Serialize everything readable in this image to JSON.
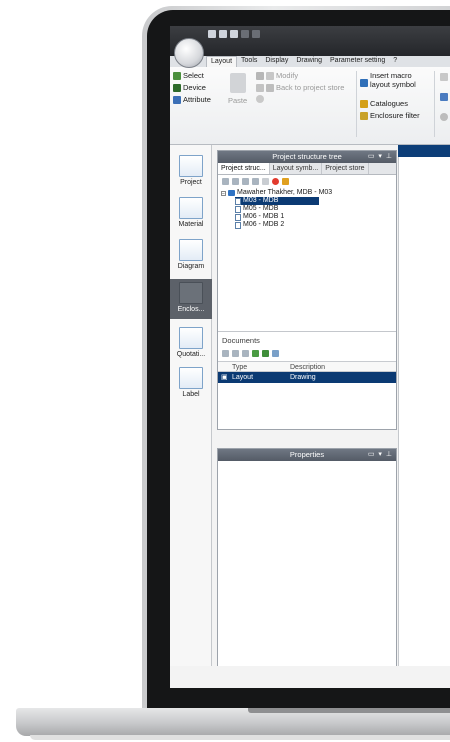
{
  "ribbon": {
    "tabs": [
      "Layout",
      "Tools",
      "Display",
      "Drawing",
      "Parameter setting",
      "?"
    ],
    "active_tab": "Layout",
    "buttons": {
      "select": "Select",
      "device": "Device",
      "attribute": "Attribute",
      "paste": "Paste",
      "modify": "Modify",
      "back_to_store": "Back to project store",
      "insert_macro_1": "Insert macro",
      "insert_macro_2": "layout symbol",
      "catalogues": "Catalogues",
      "enclosure_filter": "Enclosure filter"
    }
  },
  "navigator": {
    "items": [
      "Project",
      "Material",
      "Diagram",
      "Enclos...",
      "Quotati...",
      "Label"
    ],
    "active": "Enclos..."
  },
  "structure_panel": {
    "title": "Project structure tree",
    "tabs": [
      "Project struc...",
      "Layout symb...",
      "Project store"
    ],
    "root": "Mawaher Thakher, MDB - M03",
    "children": [
      "M03 - MDB",
      "M05 - MDB",
      "M06 - MDB 1",
      "M06 - MDB 2"
    ],
    "selected": "M03 - MDB"
  },
  "documents": {
    "title": "Documents",
    "columns": [
      "Type",
      "Description"
    ],
    "rows": [
      {
        "type": "Layout",
        "description": "Drawing"
      }
    ]
  },
  "properties_panel": {
    "title": "Properties"
  }
}
